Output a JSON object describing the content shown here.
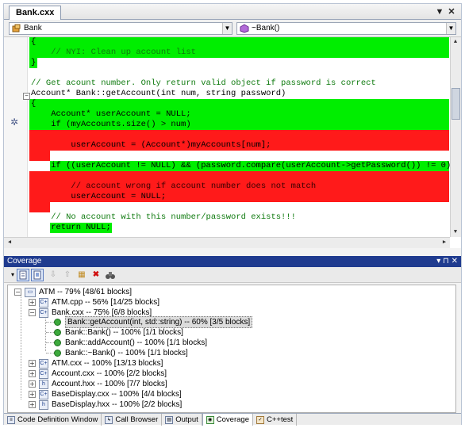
{
  "document_tab": {
    "title": "Bank.cxx"
  },
  "tab_buttons": {
    "dropdown": "▼",
    "close": "✕"
  },
  "nav": {
    "left_combo": "Bank",
    "right_combo": "~Bank()"
  },
  "code": {
    "lines": [
      {
        "text": "{",
        "class": ""
      },
      {
        "text": "    // NYI: Clean up account list",
        "class": "cmt"
      },
      {
        "text": "}",
        "class": ""
      },
      {
        "text": "",
        "class": ""
      },
      {
        "text": "// Get acount number. Only return valid object if password is correct",
        "class": "cmt"
      },
      {
        "text": "Account* Bank::getAccount(int num, string password)",
        "class": ""
      },
      {
        "text": "{",
        "class": ""
      },
      {
        "text": "    Account* userAccount = NULL;",
        "class": ""
      },
      {
        "text": "    if (myAccounts.size() > num)",
        "class": ""
      },
      {
        "text": "",
        "class": ""
      },
      {
        "text": "        userAccount = (Account*)myAccounts[num];",
        "class": ""
      },
      {
        "text": "",
        "class": ""
      },
      {
        "text": "    if ((userAccount != NULL) && (password.compare(userAccount->getPassword()) != 0))",
        "class": ""
      },
      {
        "text": "",
        "class": ""
      },
      {
        "text": "        // account wrong if account number does not match",
        "class": "cmt"
      },
      {
        "text": "        userAccount = NULL;",
        "class": ""
      },
      {
        "text": "",
        "class": ""
      },
      {
        "text": "    // No account with this number/password exists!!!",
        "class": "cmt"
      },
      {
        "text": "    return NULL;",
        "class": ""
      }
    ]
  },
  "coverage": {
    "title": "Coverage",
    "title_buttons": "▾ ⊓ ✕",
    "tree": [
      {
        "label": "ATM -- 79% [48/61 blocks]",
        "kind": "root",
        "expander": "−"
      },
      {
        "label": "ATM.cpp -- 56% [14/25 blocks]",
        "kind": "file",
        "expander": "+"
      },
      {
        "label": "Bank.cxx -- 75% [6/8 blocks]",
        "kind": "file",
        "expander": "−"
      },
      {
        "label": "Bank::getAccount(int, std::string) -- 60% [3/5 blocks]",
        "kind": "func",
        "selected": true
      },
      {
        "label": "Bank::Bank() -- 100% [1/1 blocks]",
        "kind": "func"
      },
      {
        "label": "Bank::addAccount() -- 100% [1/1 blocks]",
        "kind": "func"
      },
      {
        "label": "Bank::~Bank() -- 100% [1/1 blocks]",
        "kind": "func"
      },
      {
        "label": "ATM.cxx -- 100% [13/13 blocks]",
        "kind": "file",
        "expander": "+"
      },
      {
        "label": "Account.cxx -- 100% [2/2 blocks]",
        "kind": "file",
        "expander": "+"
      },
      {
        "label": "Account.hxx -- 100% [7/7 blocks]",
        "kind": "header",
        "expander": "+"
      },
      {
        "label": "BaseDisplay.cxx -- 100% [4/4 blocks]",
        "kind": "file",
        "expander": "+"
      },
      {
        "label": "BaseDisplay.hxx -- 100% [2/2 blocks]",
        "kind": "header",
        "expander": "+"
      }
    ]
  },
  "bottom_tabs": [
    {
      "label": "Code Definition Window"
    },
    {
      "label": "Call Browser"
    },
    {
      "label": "Output"
    },
    {
      "label": "Coverage",
      "active": true
    },
    {
      "label": "C++test"
    }
  ],
  "colors": {
    "covered": "#00ee00",
    "uncovered": "#ff1a1a",
    "comment": "#0e7a0e",
    "pane_title": "#1f3b8f"
  }
}
